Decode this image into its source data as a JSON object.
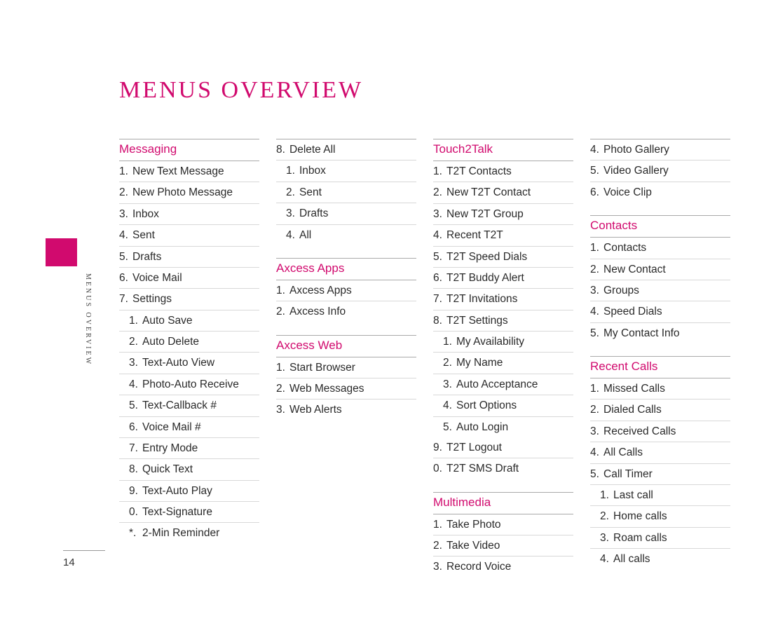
{
  "page_title": "MENUS OVERVIEW",
  "sidebar_label": "MENUS OVERVIEW",
  "page_number": "14",
  "columns": [
    [
      {
        "heading": "Messaging",
        "items": [
          {
            "num": "1.",
            "label": "New Text Message"
          },
          {
            "num": "2.",
            "label": "New Photo Message"
          },
          {
            "num": "3.",
            "label": "Inbox"
          },
          {
            "num": "4.",
            "label": "Sent"
          },
          {
            "num": "5.",
            "label": "Drafts"
          },
          {
            "num": "6.",
            "label": "Voice Mail"
          },
          {
            "num": "7.",
            "label": "Settings",
            "sub": [
              {
                "num": "1.",
                "label": "Auto Save"
              },
              {
                "num": "2.",
                "label": "Auto Delete"
              },
              {
                "num": "3.",
                "label": "Text-Auto View"
              },
              {
                "num": "4.",
                "label": "Photo-Auto Receive"
              },
              {
                "num": "5.",
                "label": "Text-Callback #"
              },
              {
                "num": "6.",
                "label": "Voice Mail #"
              },
              {
                "num": "7.",
                "label": "Entry Mode"
              },
              {
                "num": "8.",
                "label": "Quick Text"
              },
              {
                "num": "9.",
                "label": "Text-Auto Play"
              },
              {
                "num": "0.",
                "label": "Text-Signature"
              },
              {
                "num": "*.",
                "label": "2-Min Reminder"
              }
            ]
          }
        ]
      }
    ],
    [
      {
        "heading": "",
        "items": [
          {
            "num": "8.",
            "label": "Delete All",
            "sub": [
              {
                "num": "1.",
                "label": "Inbox"
              },
              {
                "num": "2.",
                "label": "Sent"
              },
              {
                "num": "3.",
                "label": "Drafts"
              },
              {
                "num": "4.",
                "label": "All"
              }
            ]
          }
        ]
      },
      {
        "heading": "Axcess Apps",
        "items": [
          {
            "num": "1.",
            "label": "Axcess Apps"
          },
          {
            "num": "2.",
            "label": "Axcess Info"
          }
        ]
      },
      {
        "heading": "Axcess Web",
        "items": [
          {
            "num": "1.",
            "label": "Start Browser"
          },
          {
            "num": "2.",
            "label": "Web Messages"
          },
          {
            "num": "3.",
            "label": "Web Alerts"
          }
        ]
      }
    ],
    [
      {
        "heading": "Touch2Talk",
        "items": [
          {
            "num": "1.",
            "label": "T2T Contacts"
          },
          {
            "num": "2.",
            "label": "New T2T Contact"
          },
          {
            "num": "3.",
            "label": "New T2T Group"
          },
          {
            "num": "4.",
            "label": "Recent T2T"
          },
          {
            "num": "5.",
            "label": "T2T Speed Dials"
          },
          {
            "num": "6.",
            "label": "T2T Buddy Alert"
          },
          {
            "num": "7.",
            "label": "T2T Invitations"
          },
          {
            "num": "8.",
            "label": "T2T Settings",
            "sub": [
              {
                "num": "1.",
                "label": "My Availability"
              },
              {
                "num": "2.",
                "label": "My Name"
              },
              {
                "num": "3.",
                "label": "Auto Acceptance"
              },
              {
                "num": "4.",
                "label": "Sort Options"
              },
              {
                "num": "5.",
                "label": "Auto Login"
              }
            ]
          },
          {
            "num": "9.",
            "label": "T2T Logout"
          },
          {
            "num": "0.",
            "label": "T2T SMS Draft"
          }
        ]
      },
      {
        "heading": "Multimedia",
        "items": [
          {
            "num": "1.",
            "label": "Take Photo"
          },
          {
            "num": "2.",
            "label": "Take Video"
          },
          {
            "num": "3.",
            "label": "Record Voice"
          }
        ]
      }
    ],
    [
      {
        "heading": "",
        "items": [
          {
            "num": "4.",
            "label": "Photo Gallery"
          },
          {
            "num": "5.",
            "label": "Video Gallery"
          },
          {
            "num": "6.",
            "label": "Voice Clip"
          }
        ]
      },
      {
        "heading": "Contacts",
        "items": [
          {
            "num": "1.",
            "label": "Contacts"
          },
          {
            "num": "2.",
            "label": "New Contact"
          },
          {
            "num": "3.",
            "label": "Groups"
          },
          {
            "num": "4.",
            "label": "Speed Dials"
          },
          {
            "num": "5.",
            "label": "My Contact Info"
          }
        ]
      },
      {
        "heading": "Recent Calls",
        "items": [
          {
            "num": "1.",
            "label": "Missed Calls"
          },
          {
            "num": "2.",
            "label": "Dialed Calls"
          },
          {
            "num": "3.",
            "label": "Received Calls"
          },
          {
            "num": "4.",
            "label": "All Calls"
          },
          {
            "num": "5.",
            "label": "Call Timer",
            "sub": [
              {
                "num": "1.",
                "label": "Last call"
              },
              {
                "num": "2.",
                "label": "Home calls"
              },
              {
                "num": "3.",
                "label": "Roam calls"
              },
              {
                "num": "4.",
                "label": "All calls"
              }
            ]
          }
        ]
      }
    ]
  ]
}
